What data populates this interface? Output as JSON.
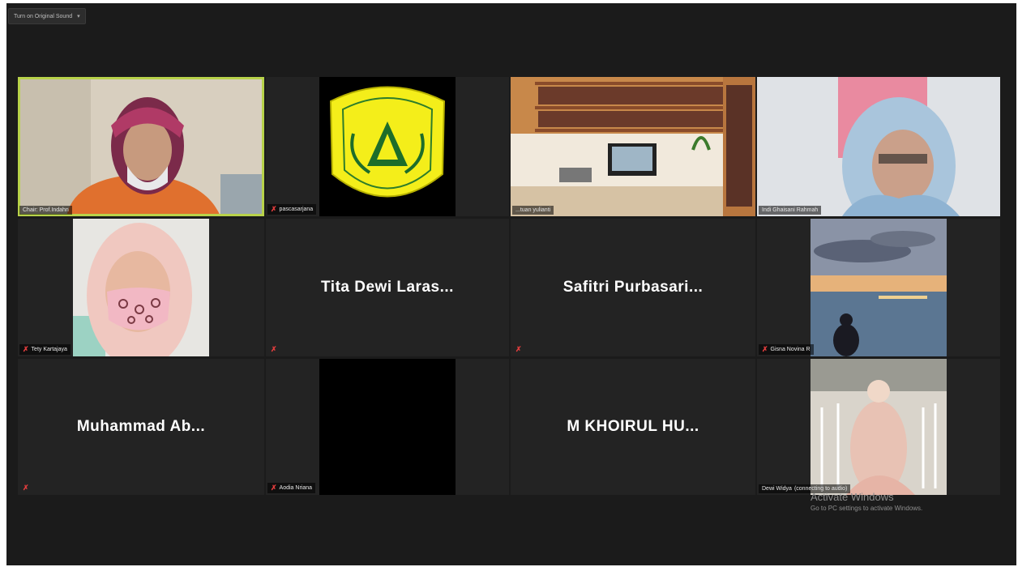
{
  "toolbar": {
    "view_label": "Turn on Original Sound",
    "caret": "▾"
  },
  "participants": [
    {
      "name": "Chair: Prof.Indahn",
      "muted": false
    },
    {
      "name": "pascasarjana",
      "muted": true
    },
    {
      "name": "...tuan yulianti",
      "muted": false
    },
    {
      "name": "Indi Ghaisani Rahmah",
      "muted": false
    },
    {
      "name": "Tety Kartajaya",
      "muted": true
    },
    {
      "name": "Tita Dewi Laras...",
      "muted": true
    },
    {
      "name": "Safitri Purbasari...",
      "muted": true
    },
    {
      "name": "Gisna Novina R",
      "muted": true
    },
    {
      "name": "Muhammad Ab...",
      "muted": true
    },
    {
      "name": "Aodia Nriana",
      "muted": true
    },
    {
      "name": "M KHOIRUL HU...",
      "muted": false
    },
    {
      "name": "Dewi Widya",
      "status": "(connecting to audio)",
      "muted": false
    }
  ],
  "watermark": {
    "title": "Activate Windows",
    "subtitle": "Go to PC settings to activate Windows."
  },
  "colors": {
    "background": "#1b1b1b",
    "tile": "#232323",
    "active_speaker": "#b8d24a",
    "mute": "#e03d3d"
  }
}
